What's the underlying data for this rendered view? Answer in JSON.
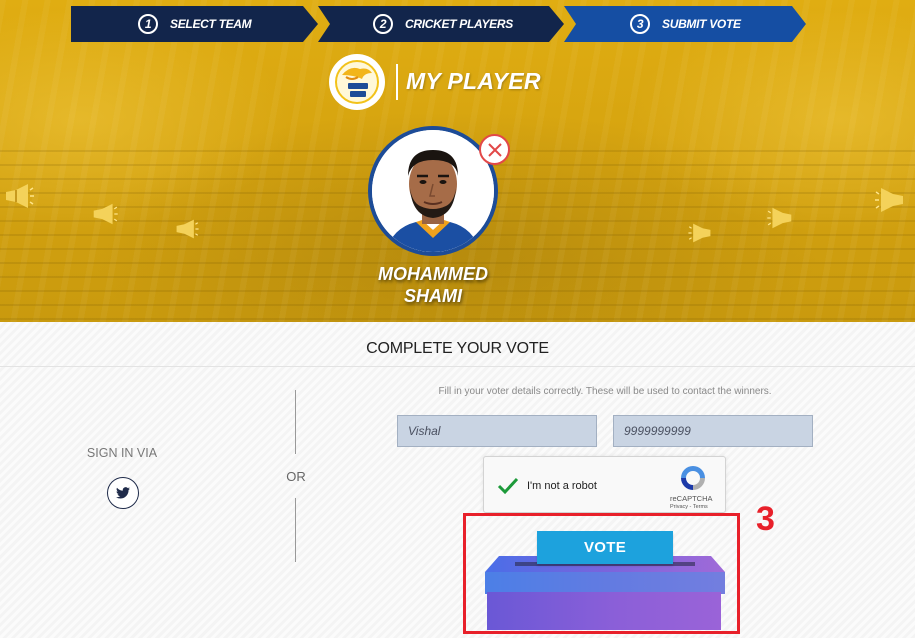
{
  "steps": [
    {
      "num": "1",
      "label": "SELECT TEAM"
    },
    {
      "num": "2",
      "label": "CRICKET PLAYERS"
    },
    {
      "num": "3",
      "label": "SUBMIT VOTE"
    }
  ],
  "header": {
    "title": "MY PLAYER",
    "team_logo_icon": "super-kings-logo"
  },
  "player": {
    "first_name": "MOHAMMED",
    "last_name": "SHAMI"
  },
  "form": {
    "title": "COMPLETE YOUR VOTE",
    "sign_in_label": "SIGN IN VIA",
    "or_label": "OR",
    "hint": "Fill in your voter details correctly. These will be used to contact the winners.",
    "name_value": "Vishal",
    "phone_value": "9999999999"
  },
  "recaptcha": {
    "label": "I'm not a robot",
    "brand": "reCAPTCHA",
    "links": "Privacy - Terms",
    "checked": true
  },
  "vote": {
    "button_label": "VOTE"
  },
  "annotation": {
    "number": "3"
  },
  "colors": {
    "hero": "#d6a410",
    "step_dark": "#12254b",
    "step_active": "#154ea3",
    "vote_button": "#1da2dd",
    "annotation": "#e8202a",
    "field_bg": "#c9d4e3"
  }
}
